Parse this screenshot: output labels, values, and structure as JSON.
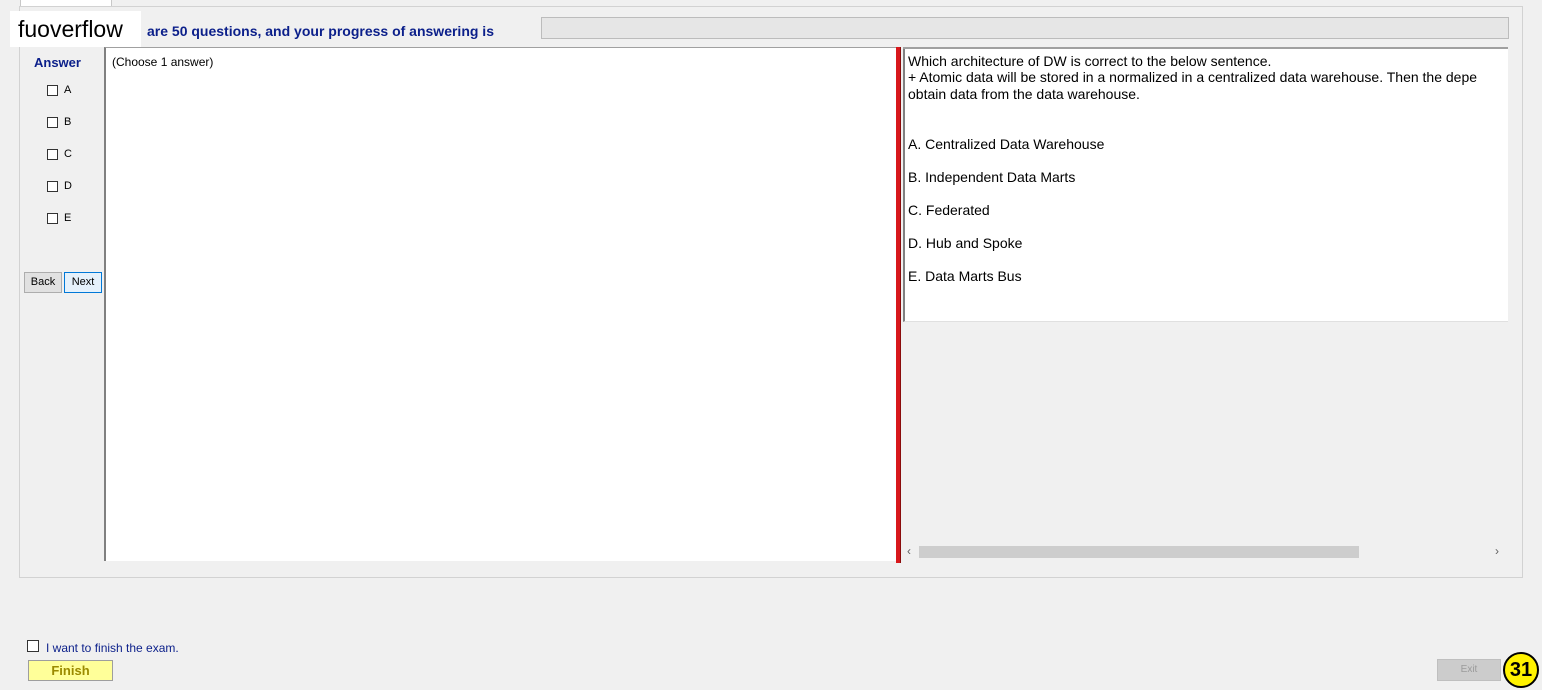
{
  "watermark": "fuoverflow",
  "header": {
    "progress_text": "are 50 questions, and your progress of answering is",
    "progress_value": 0
  },
  "answer_panel": {
    "title": "Answer",
    "options": [
      "A",
      "B",
      "C",
      "D",
      "E"
    ],
    "back_label": "Back",
    "next_label": "Next"
  },
  "instruction": "(Choose 1 answer)",
  "question": {
    "line1": "Which architecture of DW is correct to the below sentence.",
    "line2": "+ Atomic data will be stored in a normalized in a centralized data warehouse. Then the depe",
    "line3": "obtain data from the data warehouse.",
    "choices": [
      "A.  Centralized Data Warehouse",
      "B.  Independent Data Marts",
      "C.  Federated",
      "D.  Hub and Spoke",
      "E.  Data Marts Bus"
    ]
  },
  "footer": {
    "finish_checkbox_label": "I want to finish the exam.",
    "finish_label": "Finish",
    "exit_label": "Exit",
    "page_number": "31"
  },
  "colors": {
    "header_text": "#0b1f8a",
    "divider_red": "#d8181c",
    "finish_yellow": "#ffff99",
    "badge_yellow": "#fff200"
  }
}
